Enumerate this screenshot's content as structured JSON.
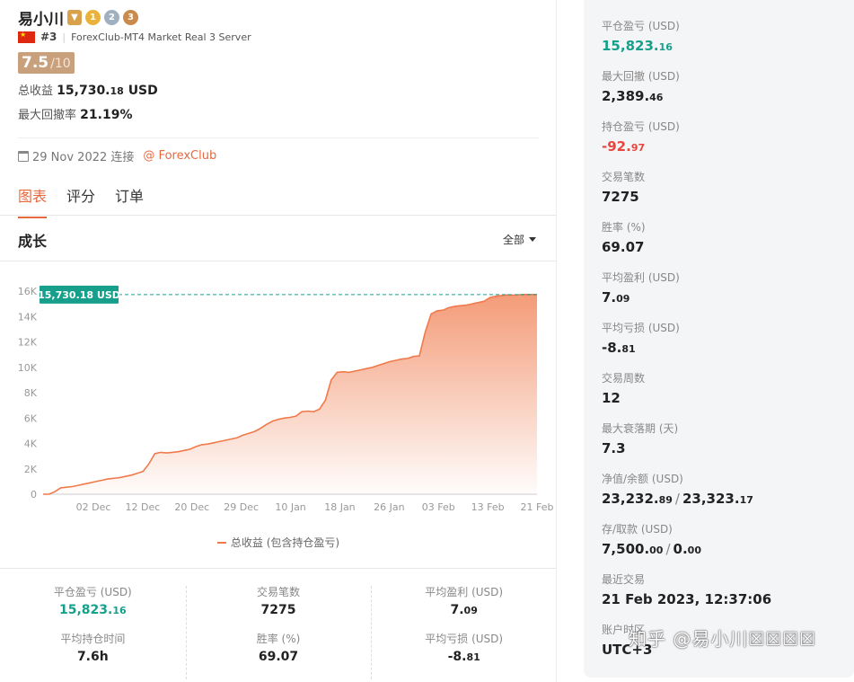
{
  "header": {
    "name": "易小川",
    "medals": [
      "trophy",
      "1",
      "2",
      "3"
    ],
    "rank": "#3",
    "server": "ForexClub-MT4 Market Real 3 Server",
    "score": "7.5",
    "score_max": "/10",
    "total_profit_label": "总收益",
    "total_profit_main": "15,730.",
    "total_profit_dec": "18",
    "total_profit_unit": "USD",
    "max_dd_label": "最大回撤率",
    "max_dd": "21.19%",
    "connected_date": "29 Nov 2022",
    "connected_label": "连接",
    "broker": "@ ForexClub"
  },
  "tabs": [
    {
      "label": "图表",
      "active": true
    },
    {
      "label": "评分"
    },
    {
      "label": "订单"
    }
  ],
  "section": {
    "title": "成长",
    "filter": "全部"
  },
  "chart_data": {
    "type": "area",
    "title": "",
    "xlabel": "",
    "ylabel": "",
    "ylim": [
      0,
      16000
    ],
    "yticks": [
      "0",
      "2K",
      "4K",
      "6K",
      "8K",
      "10K",
      "12K",
      "14K",
      "16K"
    ],
    "xticks": [
      "02 Dec",
      "12 Dec",
      "20 Dec",
      "29 Dec",
      "10 Jan",
      "18 Jan",
      "26 Jan",
      "03 Feb",
      "13 Feb",
      "21 Feb"
    ],
    "series": [
      {
        "name": "总收益 (包含持仓盈亏)",
        "color": "#f07a4b",
        "x": [
          0,
          1,
          2,
          3,
          4,
          5,
          6,
          7,
          8,
          9,
          10,
          11,
          12,
          13,
          14,
          15,
          16,
          17,
          18,
          19,
          20,
          21,
          22,
          23,
          24,
          25,
          26,
          27,
          28,
          29,
          30,
          31,
          32,
          33,
          34,
          35,
          36,
          37,
          38,
          39,
          40,
          41,
          42,
          43,
          44,
          45,
          46,
          47,
          48,
          49,
          50,
          51,
          52,
          53,
          54,
          55,
          56,
          57,
          58,
          59,
          60,
          61,
          62,
          63,
          64,
          65,
          66,
          67,
          68,
          69,
          70,
          71,
          72,
          73,
          74,
          75,
          76,
          77,
          78,
          79,
          80,
          81,
          82,
          83,
          84
        ],
        "values": [
          0,
          0,
          200,
          500,
          550,
          600,
          700,
          800,
          900,
          1000,
          1100,
          1200,
          1250,
          1300,
          1400,
          1500,
          1650,
          1800,
          2400,
          3200,
          3300,
          3250,
          3300,
          3350,
          3450,
          3550,
          3750,
          3900,
          3950,
          4050,
          4150,
          4250,
          4350,
          4450,
          4650,
          4800,
          4950,
          5200,
          5500,
          5750,
          5900,
          6000,
          6050,
          6150,
          6500,
          6550,
          6500,
          6700,
          7400,
          9000,
          9600,
          9650,
          9600,
          9700,
          9800,
          9900,
          10000,
          10150,
          10300,
          10450,
          10550,
          10650,
          10700,
          10850,
          10900,
          12800,
          14200,
          14450,
          14500,
          14700,
          14800,
          14850,
          14900,
          15000,
          15100,
          15200,
          15500,
          15600,
          15650,
          15700,
          15680,
          15720,
          15730,
          15730,
          15730
        ],
        "last_value_label": "15,730.18 USD"
      }
    ],
    "legend": "bottom",
    "grid": false
  },
  "stats": [
    [
      {
        "label": "平仓盈亏 (USD)",
        "main": "15,823.",
        "dec": "16",
        "color": "green"
      },
      {
        "label": "平均持仓时间",
        "main": "7.6h",
        "dec": ""
      }
    ],
    [
      {
        "label": "交易笔数",
        "main": "7275",
        "dec": ""
      },
      {
        "label": "胜率 (%)",
        "main": "69.07",
        "dec": ""
      }
    ],
    [
      {
        "label": "平均盈利 (USD)",
        "main": "7.",
        "dec": "09"
      },
      {
        "label": "平均亏损 (USD)",
        "main": "-8.",
        "dec": "81"
      }
    ]
  ],
  "right": [
    {
      "label": "平仓盈亏 (USD)",
      "main": "15,823.",
      "dec": "16",
      "color": "green"
    },
    {
      "label": "最大回撤 (USD)",
      "main": "2,389.",
      "dec": "46"
    },
    {
      "label": "持仓盈亏 (USD)",
      "main": "-92.",
      "dec": "97",
      "color": "red"
    },
    {
      "label": "交易笔数",
      "main": "7275",
      "dec": ""
    },
    {
      "label": "胜率 (%)",
      "main": "69.07",
      "dec": ""
    },
    {
      "label": "平均盈利 (USD)",
      "main": "7.",
      "dec": "09"
    },
    {
      "label": "平均亏损 (USD)",
      "main": "-8.",
      "dec": "81"
    },
    {
      "label": "交易周数",
      "main": "12",
      "dec": ""
    },
    {
      "label": "最大衰落期 (天)",
      "main": "7.3",
      "dec": ""
    },
    {
      "label": "净值/余额 (USD)",
      "main": "23,232.",
      "dec": "89",
      "main2": "23,323.",
      "dec2": "17"
    },
    {
      "label": "存/取款 (USD)",
      "main": "7,500.",
      "dec": "00",
      "main2": "0.",
      "dec2": "00"
    },
    {
      "label": "最近交易",
      "main": "21 Feb 2023, 12:37:06",
      "dec": "",
      "norm": true
    },
    {
      "label": "账户时区",
      "main": "UTC+3",
      "dec": "",
      "norm": true
    }
  ],
  "watermark": "知乎 @易小川☒☒☒☒",
  "colors": {
    "accent": "#e8693f",
    "green": "#16a08c",
    "red": "#e8453c",
    "line": "#f07a4b",
    "badge": "#16a08c"
  }
}
